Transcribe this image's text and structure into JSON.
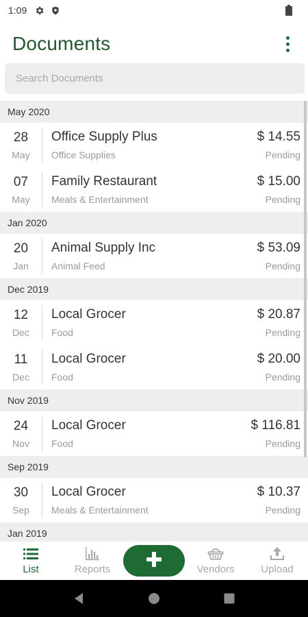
{
  "status_bar": {
    "time": "1:09",
    "icons": [
      "gear-icon",
      "shield-icon",
      "battery-icon"
    ]
  },
  "header": {
    "title": "Documents",
    "menu_icon": "more-vert-icon"
  },
  "search": {
    "placeholder": "Search Documents",
    "value": ""
  },
  "sections": [
    {
      "label": "May 2020",
      "items": [
        {
          "day": "28",
          "month": "May",
          "vendor": "Office Supply Plus",
          "category": "Office Supplies",
          "amount": "$ 14.55",
          "status": "Pending"
        },
        {
          "day": "07",
          "month": "May",
          "vendor": "Family Restaurant",
          "category": "Meals & Entertainment",
          "amount": "$ 15.00",
          "status": "Pending"
        }
      ]
    },
    {
      "label": "Jan 2020",
      "items": [
        {
          "day": "20",
          "month": "Jan",
          "vendor": "Animal Supply Inc",
          "category": "Animal Feed",
          "amount": "$ 53.09",
          "status": "Pending"
        }
      ]
    },
    {
      "label": "Dec 2019",
      "items": [
        {
          "day": "12",
          "month": "Dec",
          "vendor": "Local Grocer",
          "category": "Food",
          "amount": "$ 20.87",
          "status": "Pending"
        },
        {
          "day": "11",
          "month": "Dec",
          "vendor": "Local Grocer",
          "category": "Food",
          "amount": "$ 20.00",
          "status": "Pending"
        }
      ]
    },
    {
      "label": "Nov 2019",
      "items": [
        {
          "day": "24",
          "month": "Nov",
          "vendor": "Local Grocer",
          "category": "Food",
          "amount": "$ 116.81",
          "status": "Pending"
        }
      ]
    },
    {
      "label": "Sep 2019",
      "items": [
        {
          "day": "30",
          "month": "Sep",
          "vendor": "Local Grocer",
          "category": "Meals & Entertainment",
          "amount": "$ 10.37",
          "status": "Pending"
        }
      ]
    },
    {
      "label": "Jan 2019",
      "items": []
    }
  ],
  "bottom_nav": {
    "items": [
      {
        "label": "List",
        "icon": "list-icon",
        "active": true
      },
      {
        "label": "Reports",
        "icon": "bar-chart-icon",
        "active": false
      },
      {
        "label": "",
        "icon": "plus-icon",
        "active": false
      },
      {
        "label": "Vendors",
        "icon": "basket-icon",
        "active": false
      },
      {
        "label": "Upload",
        "icon": "upload-icon",
        "active": false
      }
    ]
  },
  "system_nav": [
    "back-icon",
    "home-icon",
    "recents-icon"
  ],
  "colors": {
    "accent": "#1e6b34",
    "title": "#1e5a2e",
    "section_bg": "#eeeeee",
    "muted_text": "#9a9a9a",
    "inactive_nav": "#a8a8a8"
  }
}
